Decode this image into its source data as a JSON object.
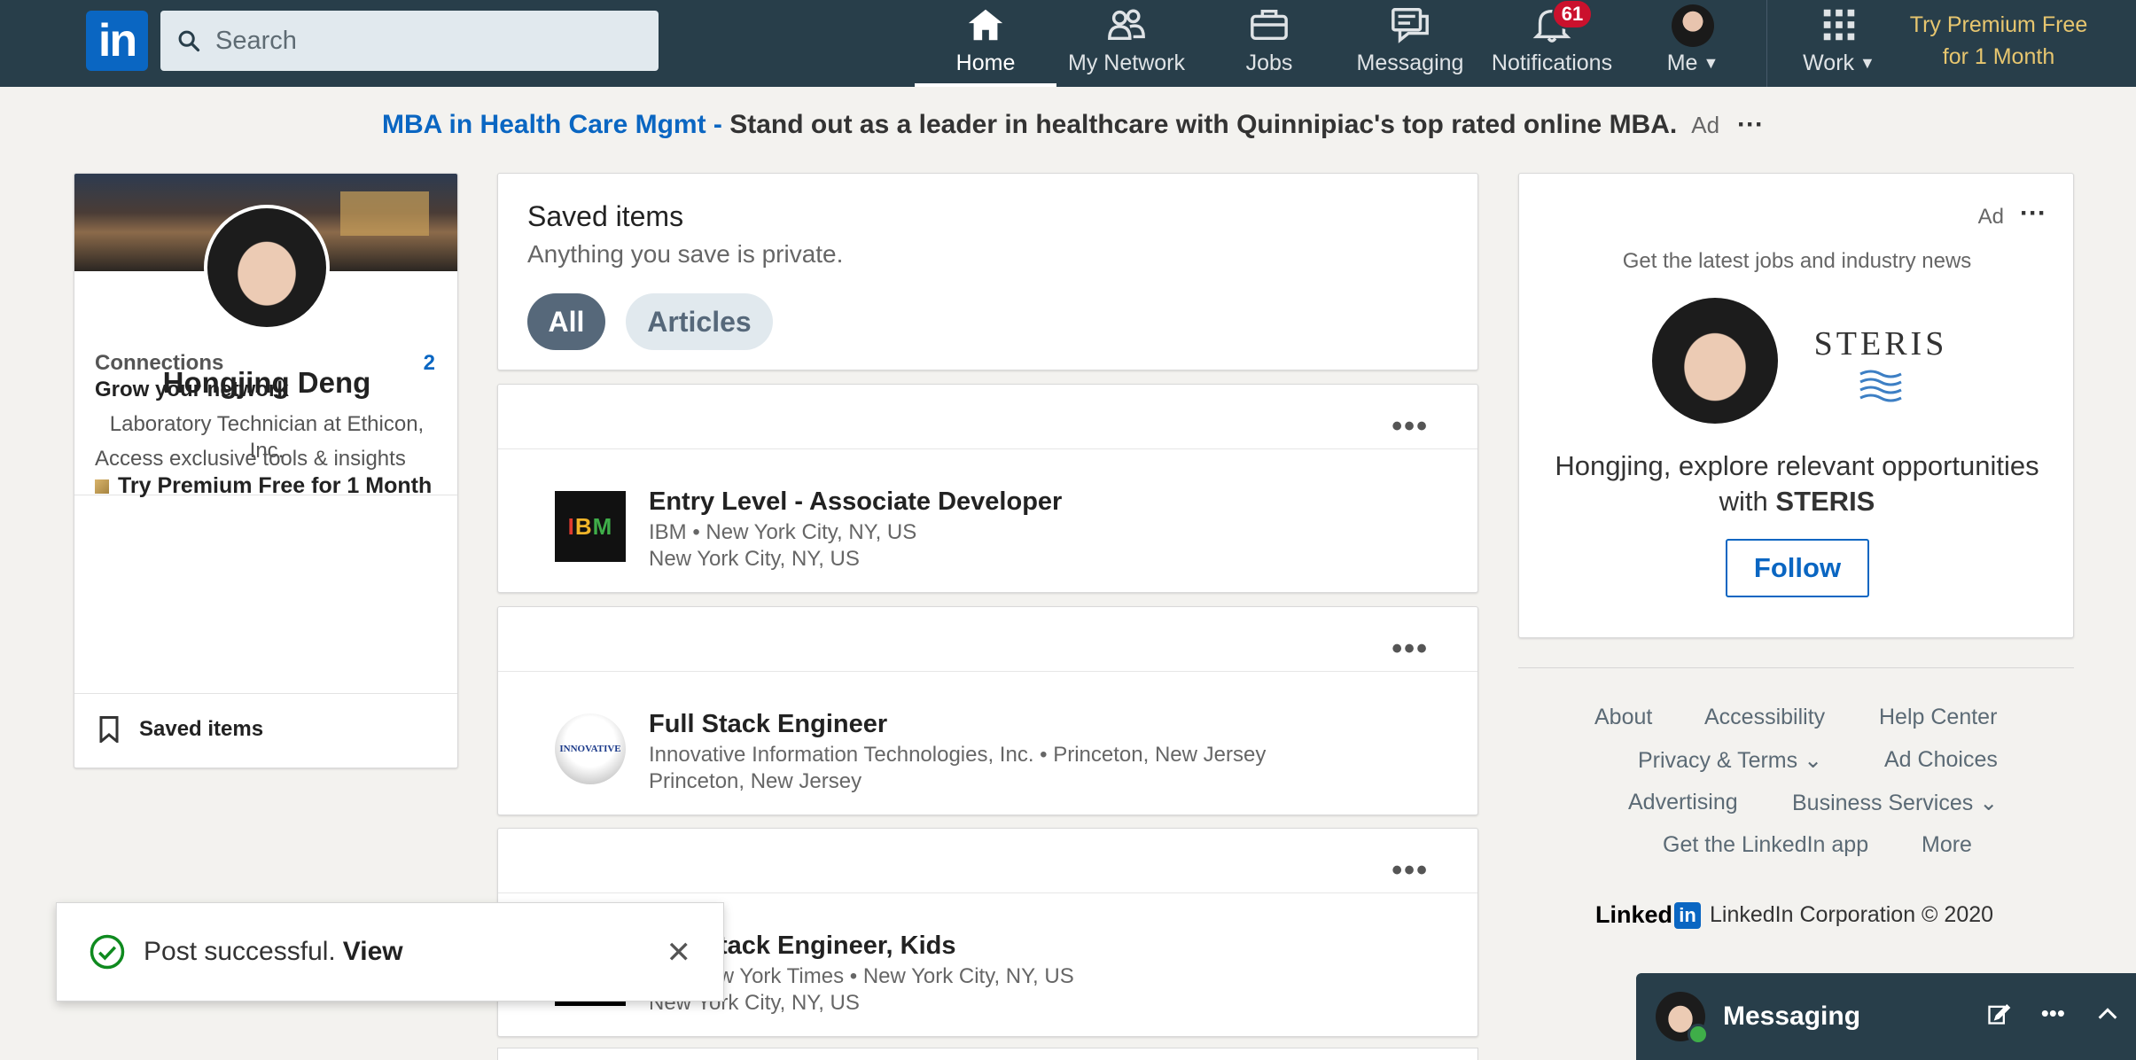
{
  "nav": {
    "logo": "in",
    "search_placeholder": "Search",
    "items": [
      {
        "label": "Home",
        "icon": "home-icon"
      },
      {
        "label": "My Network",
        "icon": "network-icon"
      },
      {
        "label": "Jobs",
        "icon": "briefcase-icon"
      },
      {
        "label": "Messaging",
        "icon": "messaging-icon"
      },
      {
        "label": "Notifications",
        "icon": "bell-icon",
        "badge": "61"
      },
      {
        "label": "Me",
        "icon": "avatar"
      },
      {
        "label": "Work",
        "icon": "grid-icon"
      }
    ],
    "premium": "Try Premium Free for 1 Month"
  },
  "ad_banner": {
    "link": "MBA in Health Care Mgmt - ",
    "text": "Stand out as a leader in healthcare with Quinnipiac's top rated online MBA.",
    "tag": "Ad",
    "menu": "···"
  },
  "profile": {
    "name": "Hongjing Deng",
    "title": "Laboratory Technician at Ethicon, Inc.",
    "connections_label": "Connections",
    "connections_count": "2",
    "grow": "Grow your network",
    "access": "Access exclusive tools & insights",
    "premium": "Try Premium Free for 1 Month",
    "saved": "Saved items"
  },
  "saved_header": {
    "title": "Saved items",
    "subtitle": "Anything you save is private.",
    "filters": [
      "All",
      "Articles"
    ]
  },
  "jobs": [
    {
      "title": "Entry Level - Associate Developer",
      "company": "IBM • New York City, NY, US",
      "location": "New York City, NY, US",
      "logo": "IBM"
    },
    {
      "title": "Full Stack Engineer",
      "company": "Innovative Information Technologies, Inc. • Princeton, New Jersey",
      "location": "Princeton, New Jersey",
      "logo": "INNOVATIVE"
    },
    {
      "title": "Full Stack Engineer, Kids",
      "company": "The New York Times • New York City, NY, US",
      "location": "New York City, NY, US",
      "logo": ""
    }
  ],
  "right_ad": {
    "tag": "Ad",
    "menu": "···",
    "headline": "Get the latest jobs and industry news",
    "brand": "STERIS",
    "text_prefix": "Hongjing, explore relevant opportunities with ",
    "text_brand": "STERIS",
    "follow": "Follow"
  },
  "footer": {
    "links": [
      "About",
      "Accessibility",
      "Help Center",
      "Privacy & Terms ⌄",
      "Ad Choices",
      "Advertising",
      "Business Services ⌄",
      "Get the LinkedIn app",
      "More"
    ],
    "brand_word": "Linked",
    "brand_box": "in",
    "copyright": "LinkedIn Corporation © 2020"
  },
  "messaging": {
    "label": "Messaging"
  },
  "toast": {
    "message": "Post successful.",
    "action": "View"
  },
  "colors": {
    "nav_bg": "#283e4a",
    "accent": "#0a66c2",
    "premium_gold": "#e7c66f",
    "badge_red": "#cb112d"
  }
}
